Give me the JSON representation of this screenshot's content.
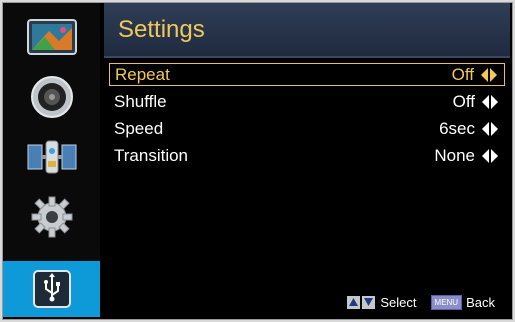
{
  "header": {
    "title": "Settings"
  },
  "sidebar": {
    "items": [
      {
        "icon": "picture-icon",
        "selected": false
      },
      {
        "icon": "sound-icon",
        "selected": false
      },
      {
        "icon": "satellite-icon",
        "selected": false
      },
      {
        "icon": "gear-icon",
        "selected": false
      },
      {
        "icon": "usb-icon",
        "selected": true
      }
    ]
  },
  "settings": [
    {
      "label": "Repeat",
      "value": "Off",
      "selected": true
    },
    {
      "label": "Shuffle",
      "value": "Off",
      "selected": false
    },
    {
      "label": "Speed",
      "value": "6sec",
      "selected": false
    },
    {
      "label": "Transition",
      "value": "None",
      "selected": false
    }
  ],
  "footer": {
    "select_label": "Select",
    "menu_key": "MENU",
    "back_label": "Back"
  },
  "colors": {
    "accent": "#f0c95a",
    "selected_sidebar": "#0e9ad8",
    "header_bg": "#27344b"
  }
}
